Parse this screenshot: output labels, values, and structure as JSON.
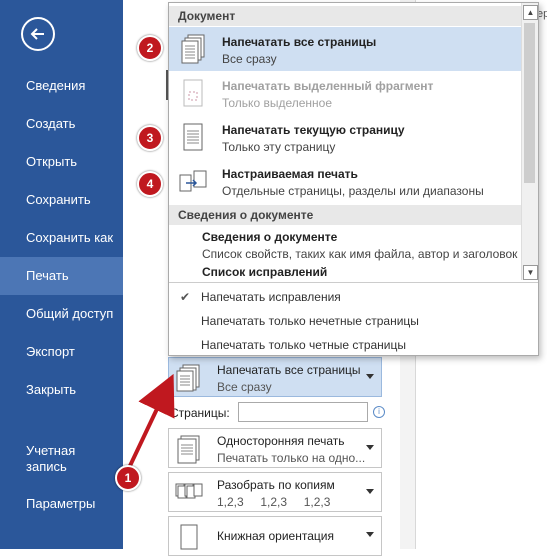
{
  "sidebar": {
    "items": [
      {
        "label": "Сведения"
      },
      {
        "label": "Создать"
      },
      {
        "label": "Открыть"
      },
      {
        "label": "Сохранить"
      },
      {
        "label": "Сохранить как"
      },
      {
        "label": "Печать"
      },
      {
        "label": "Общий доступ"
      },
      {
        "label": "Экспорт"
      },
      {
        "label": "Закрыть"
      },
      {
        "label": "Учетная запись"
      },
      {
        "label": "Параметры"
      }
    ],
    "active": "Печать"
  },
  "dropdown": {
    "section1": "Документ",
    "items": [
      {
        "title": "Напечатать все страницы",
        "sub": "Все сразу",
        "selected": true
      },
      {
        "title": "Напечатать выделенный фрагмент",
        "sub": "Только выделенное",
        "disabled": true
      },
      {
        "title": "Напечатать текущую страницу",
        "sub": "Только эту страницу"
      },
      {
        "title": "Настраиваемая печать",
        "sub": "Отдельные страницы, разделы или диапазоны"
      }
    ],
    "section2": "Сведения о документе",
    "doc_info_title": "Сведения о документе",
    "doc_info_sub": "Список свойств, таких как имя файла, автор и заголовок",
    "revisions": "Список исправлений",
    "options": [
      {
        "label": "Напечатать исправления",
        "checked": true
      },
      {
        "label": "Напечатать только нечетные страницы"
      },
      {
        "label": "Напечатать только четные страницы"
      }
    ]
  },
  "settings": {
    "range_title": "Напечатать все страницы",
    "range_sub": "Все сразу",
    "pages_label": "Страницы:",
    "pages_value": "",
    "sides_title": "Односторонняя печать",
    "sides_sub": "Печатать только на одно...",
    "collate_title": "Разобрать по копиям",
    "collate_sub": "1,2,3     1,2,3     1,2,3",
    "orientation_title": "Книжная ориентация"
  },
  "badges": [
    "1",
    "2",
    "3",
    "4"
  ],
  "edge_text": "ер",
  "colors": {
    "sidebar": "#2b579a",
    "active": "#4c76b5",
    "highlight": "#cfdff2",
    "badge": "#c0181f",
    "arrow": "#c0181f"
  },
  "icons": [
    "back-arrow-icon",
    "print-all-icon",
    "print-selection-icon",
    "print-current-icon",
    "custom-print-icon",
    "checkmark-icon",
    "info-icon",
    "chevron-down-icon",
    "scroll-up-icon",
    "scroll-down-icon"
  ]
}
